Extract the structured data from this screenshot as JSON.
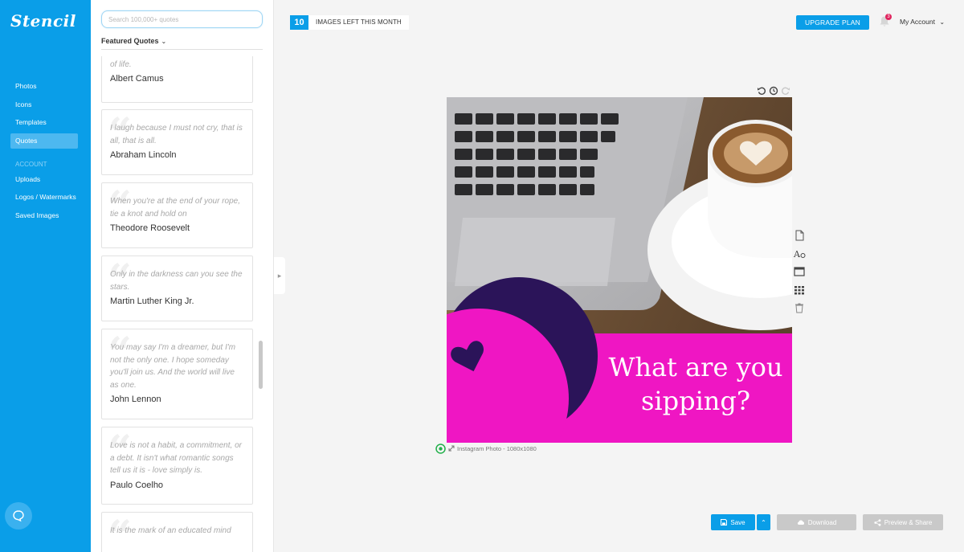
{
  "app": {
    "logo": "Stencil"
  },
  "sidebar": {
    "items": [
      {
        "label": "Photos"
      },
      {
        "label": "Icons"
      },
      {
        "label": "Templates"
      },
      {
        "label": "Quotes",
        "active": true
      }
    ],
    "account_section": "ACCOUNT",
    "account_items": [
      {
        "label": "Uploads"
      },
      {
        "label": "Logos / Watermarks"
      },
      {
        "label": "Saved Images"
      }
    ]
  },
  "quotes_panel": {
    "search_placeholder": "Search 100,000+ quotes",
    "featured_label": "Featured Quotes",
    "quotes": [
      {
        "text": "live if you are looking for the meaning of life.",
        "author": "Albert Camus"
      },
      {
        "text": "I laugh because I must not cry, that is all, that is all.",
        "author": "Abraham Lincoln"
      },
      {
        "text": "When you're at the end of your rope, tie a knot and hold on",
        "author": "Theodore Roosevelt"
      },
      {
        "text": "Only in the darkness can you see the stars.",
        "author": "Martin Luther King Jr."
      },
      {
        "text": "You may say I'm a dreamer, but I'm not the only one. I hope someday you'll join us. And the world will live as one.",
        "author": "John Lennon"
      },
      {
        "text": "Love is not a habit, a commitment, or a debt. It isn't what romantic songs tell us it is - love simply is.",
        "author": "Paulo Coelho"
      },
      {
        "text": "It is the mark of an educated mind",
        "author": ""
      }
    ]
  },
  "topbar": {
    "images_left_count": "10",
    "images_left_label": "IMAGES LEFT THIS MONTH",
    "upgrade_label": "UPGRADE PLAN",
    "notification_count": "3",
    "account_label": "My Account"
  },
  "canvas": {
    "headline": "What are you sipping?",
    "format_label": "Instagram Photo - 1080x1080"
  },
  "actions": {
    "save_label": "Save",
    "download_label": "Download",
    "share_label": "Preview & Share"
  },
  "colors": {
    "brand_blue": "#0a9ee8",
    "pink": "#ef16c3",
    "navy": "#2b1459"
  }
}
